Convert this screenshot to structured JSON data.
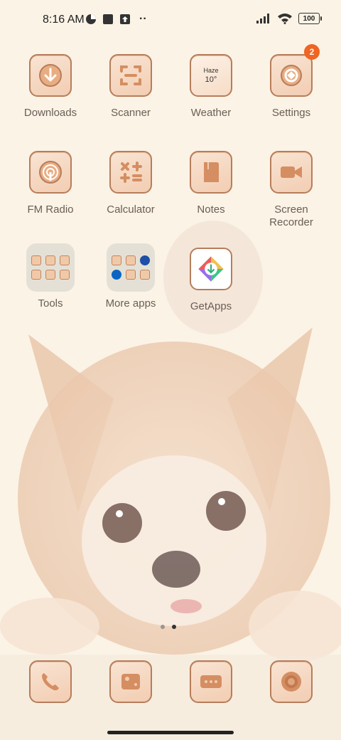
{
  "status_bar": {
    "time": "8:16 AM",
    "battery": "100",
    "more_indicator": "··"
  },
  "apps": [
    {
      "label": "Downloads",
      "icon": "download-icon"
    },
    {
      "label": "Scanner",
      "icon": "scanner-icon"
    },
    {
      "label": "Weather",
      "icon": "weather-icon",
      "weather_text": "Haze",
      "temperature": "10°"
    },
    {
      "label": "Settings",
      "icon": "gear-icon",
      "badge": "2"
    },
    {
      "label": "FM Radio",
      "icon": "radio-icon"
    },
    {
      "label": "Calculator",
      "icon": "calculator-icon"
    },
    {
      "label": "Notes",
      "icon": "notes-icon"
    },
    {
      "label": "Screen\nRecorder",
      "icon": "video-camera-icon"
    },
    {
      "label": "Tools",
      "icon": "folder-icon"
    },
    {
      "label": "More apps",
      "icon": "folder-icon"
    },
    {
      "label": "GetApps",
      "icon": "getapps-icon"
    }
  ],
  "dock": [
    {
      "icon": "phone-icon"
    },
    {
      "icon": "gallery-icon"
    },
    {
      "icon": "messages-icon"
    },
    {
      "icon": "camera-icon"
    }
  ],
  "page_indicator": {
    "pages": 2,
    "current": 2
  },
  "colors": {
    "background": "#fbf3e6",
    "icon_fill": "#f2cdb2",
    "icon_border": "#b77d5b",
    "badge": "#ef6522",
    "label": "#6b5e55"
  }
}
